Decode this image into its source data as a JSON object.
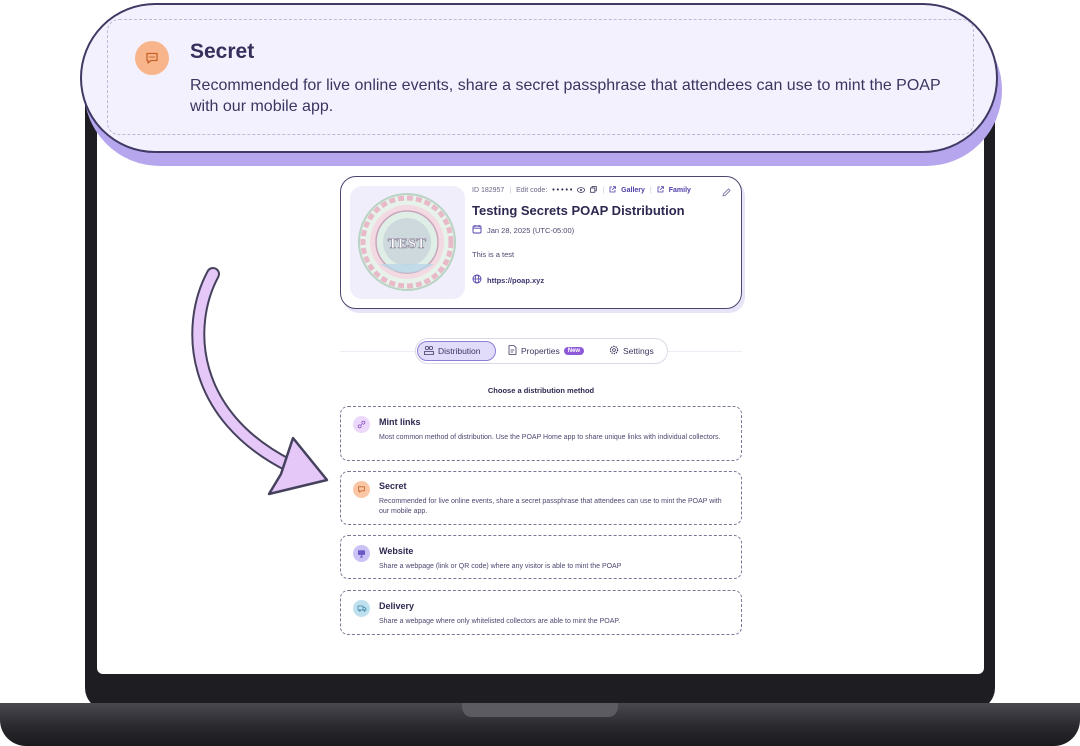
{
  "callout": {
    "title": "Secret",
    "description": "Recommended for live online events, share a secret passphrase that attendees can use to mint the POAP with our mobile app.",
    "icon": "chat-bubble-icon"
  },
  "event_card": {
    "id_label": "ID 182957",
    "edit_code_label": "Edit code:",
    "edit_code_mask": "• • • • •",
    "gallery_label": "Gallery",
    "family_label": "Family",
    "title": "Testing Secrets POAP Distribution",
    "date": "Jan 28, 2025 (UTC-05:00)",
    "description": "This is a test",
    "url": "https://poap.xyz",
    "badge_text": "TEST"
  },
  "tabs": [
    {
      "label": "Distribution",
      "icon": "users-icon",
      "active": true
    },
    {
      "label": "Properties",
      "icon": "file-edit-icon",
      "badge": "New"
    },
    {
      "label": "Settings",
      "icon": "gear-icon"
    }
  ],
  "section_title": "Choose a distribution method",
  "options": [
    {
      "title": "Mint links",
      "description": "Most common method of distribution. Use the POAP Home app to share unique links with individual collectors.",
      "icon": "link-icon",
      "color": "#ecd8fa"
    },
    {
      "title": "Secret",
      "description": "Recommended for live online events, share a secret passphrase that attendees can use to mint the POAP with our mobile app.",
      "icon": "chat-bubble-icon",
      "color": "#fbc6a5"
    },
    {
      "title": "Website",
      "description": "Share a webpage (link or QR code) where any visitor is able to mint the POAP",
      "icon": "monitor-icon",
      "color": "#cbc2f5"
    },
    {
      "title": "Delivery",
      "description": "Share a webpage where only whitelisted collectors are able to mint the POAP.",
      "icon": "delivery-truck-icon",
      "color": "#bfe1ef"
    }
  ],
  "colors": {
    "accent": "#8b7fd6",
    "callout_bg": "#f4f1fe",
    "callout_shadow": "#b6a6ee",
    "arrow": "#e3c4f7"
  }
}
